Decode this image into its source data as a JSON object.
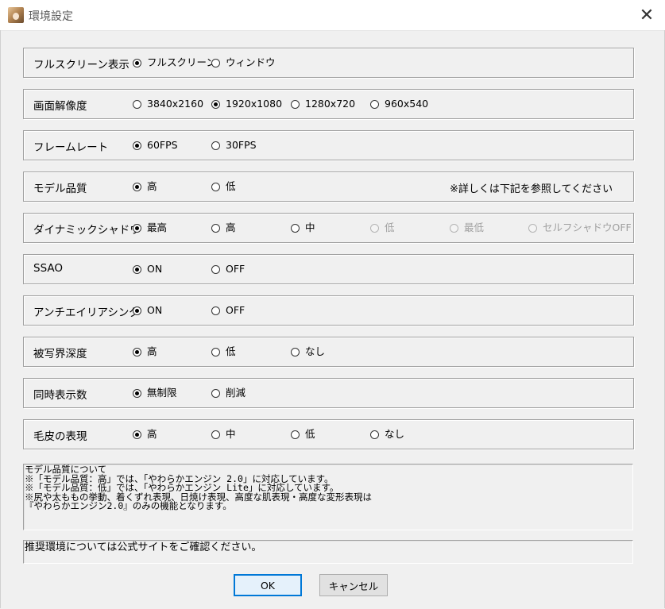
{
  "window": {
    "title": "環境設定",
    "close_glyph": "✕"
  },
  "groups": [
    {
      "key": "fullscreen",
      "label": "フルスクリーン表示",
      "options": [
        {
          "label": "フルスクリーン",
          "checked": true
        },
        {
          "label": "ウィンドウ",
          "checked": false
        }
      ]
    },
    {
      "key": "resolution",
      "label": "画面解像度",
      "options": [
        {
          "label": "3840x2160",
          "checked": false
        },
        {
          "label": "1920x1080",
          "checked": true
        },
        {
          "label": "1280x720",
          "checked": false
        },
        {
          "label": "960x540",
          "checked": false
        }
      ]
    },
    {
      "key": "framerate",
      "label": "フレームレート",
      "options": [
        {
          "label": "60FPS",
          "checked": true
        },
        {
          "label": "30FPS",
          "checked": false
        }
      ]
    },
    {
      "key": "model_quality",
      "label": "モデル品質",
      "options": [
        {
          "label": "高",
          "checked": true
        },
        {
          "label": "低",
          "checked": false
        }
      ],
      "note": "※詳しくは下記を参照してください"
    },
    {
      "key": "dynamic_shadow",
      "label": "ダイナミックシャドウ",
      "options": [
        {
          "label": "最高",
          "checked": true
        },
        {
          "label": "高",
          "checked": false
        },
        {
          "label": "中",
          "checked": false
        },
        {
          "label": "低",
          "checked": false,
          "disabled": true
        },
        {
          "label": "最低",
          "checked": false,
          "disabled": true
        },
        {
          "label": "セルフシャドウOFF",
          "checked": false,
          "disabled": true
        }
      ]
    },
    {
      "key": "ssao",
      "label": "SSAO",
      "options": [
        {
          "label": "ON",
          "checked": true
        },
        {
          "label": "OFF",
          "checked": false
        }
      ]
    },
    {
      "key": "antialiasing",
      "label": "アンチエイリアシング",
      "options": [
        {
          "label": "ON",
          "checked": true
        },
        {
          "label": "OFF",
          "checked": false
        }
      ]
    },
    {
      "key": "dof",
      "label": "被写界深度",
      "options": [
        {
          "label": "高",
          "checked": true
        },
        {
          "label": "低",
          "checked": false
        },
        {
          "label": "なし",
          "checked": false
        }
      ]
    },
    {
      "key": "simultaneous",
      "label": "同時表示数",
      "options": [
        {
          "label": "無制限",
          "checked": true
        },
        {
          "label": "削減",
          "checked": false
        }
      ]
    },
    {
      "key": "fur",
      "label": "毛皮の表現",
      "options": [
        {
          "label": "高",
          "checked": true
        },
        {
          "label": "中",
          "checked": false
        },
        {
          "label": "低",
          "checked": false
        },
        {
          "label": "なし",
          "checked": false
        }
      ]
    }
  ],
  "info_text": [
    "モデル品質について",
    "※「モデル品質：高」では、「やわらかエンジン 2.0」に対応しています。",
    "※「モデル品質：低」では、「やわらかエンジン Lite」に対応しています。",
    "※尻や太ももの挙動、着くずれ表現、日焼け表現、高度な肌表現・高度な変形表現は",
    "『やわらかエンジン2.0』のみの機能となります。"
  ],
  "recommend_text": "推奨環境については公式サイトをご確認ください。",
  "buttons": {
    "ok": "OK",
    "cancel": "キャンセル"
  }
}
